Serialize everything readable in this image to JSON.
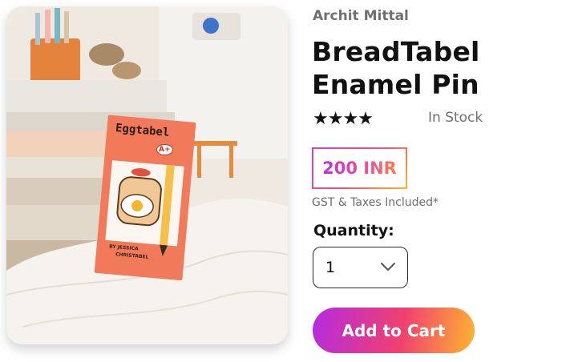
{
  "product": {
    "seller": "Archit Mittal",
    "title": "BreadTabel Enamel Pin",
    "rating_stars": "★★★★",
    "rating_value": 4,
    "stock_status": "In Stock",
    "price": "200 INR",
    "tax_note": "GST & Taxes Included*",
    "image_alt": "Eggtabel enamel pin card",
    "card_brand": "Eggtabel",
    "card_grade": "A+",
    "card_credit_line1": "BY JESSICA",
    "card_credit_line2": "CHRISTABEL"
  },
  "quantity": {
    "label": "Quantity:",
    "value": "1"
  },
  "actions": {
    "add_to_cart": "Add to Cart"
  },
  "colors": {
    "accent_start": "#b42be0",
    "accent_mid": "#f0406f",
    "accent_end": "#ffb62e",
    "card": "#f07a5a"
  }
}
